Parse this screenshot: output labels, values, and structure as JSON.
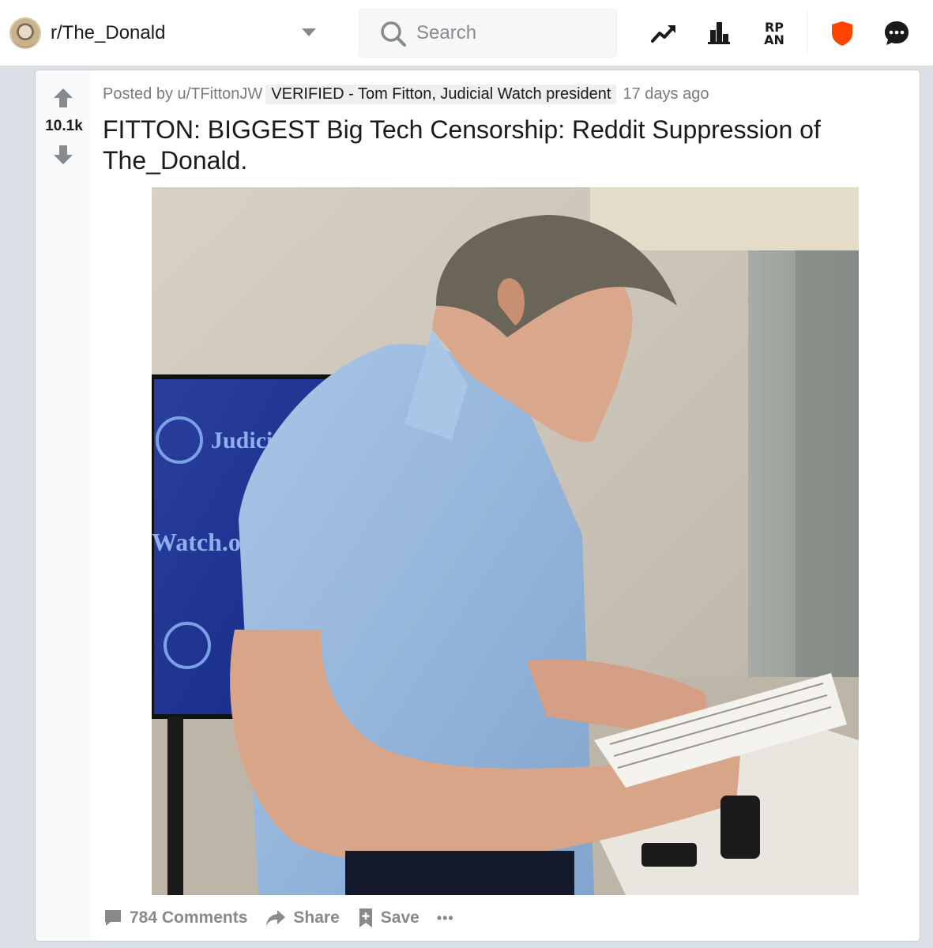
{
  "header": {
    "subreddit": "r/The_Donald",
    "search_placeholder": "Search",
    "icons": [
      "trending-icon",
      "leaderboard-icon",
      "rpan-icon",
      "shield-icon",
      "chat-icon"
    ],
    "rpan_label": "RP AN"
  },
  "post": {
    "score": "10.1k",
    "posted_by_prefix": "Posted by",
    "author": "u/TFittonJW",
    "flair": "VERIFIED - Tom Fitton, Judicial Watch president",
    "age": "17 days ago",
    "title": "FITTON: BIGGEST Big Tech Censorship: Reddit Suppression of The_Donald.",
    "image_text": {
      "banner_top": "Judicial",
      "banner_bottom": "Watch.o"
    },
    "actions": {
      "comments": "784 Comments",
      "share": "Share",
      "save": "Save",
      "more": "•••"
    }
  },
  "colors": {
    "shield": "#ff4500",
    "brand_background": "#dae0e6",
    "text_secondary": "#787c7e"
  }
}
